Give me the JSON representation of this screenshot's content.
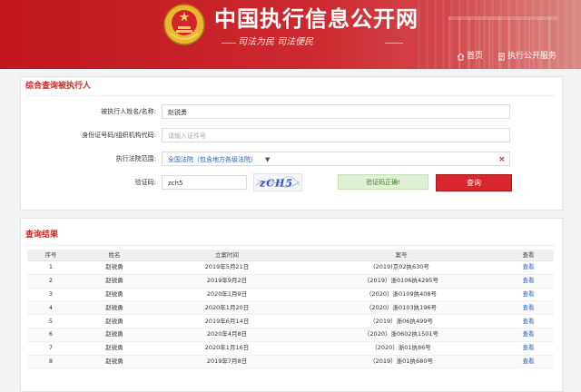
{
  "header": {
    "site_title": "中国执行信息公开网",
    "slogan": "司法为民  司法便民",
    "nav": [
      {
        "label": "首页",
        "icon": "home-icon"
      },
      {
        "label": "执行公开服务",
        "icon": "document-icon"
      }
    ]
  },
  "colors": {
    "brand_red": "#c1161e",
    "link_blue": "#2b63b8",
    "success_green": "#3f7d23"
  },
  "form": {
    "title": "综合查询被执行人",
    "name_label": "被执行人姓名/名称:",
    "name_value": "赵锐勇",
    "id_label": "身份证号码/组织机构代码:",
    "id_placeholder": "请输入证件号",
    "court_label": "执行法院范围:",
    "court_value": "全国法院（包含地方各级法院）",
    "captcha_label": "验证码:",
    "captcha_value": "zch5",
    "captcha_image_text": "zCH5",
    "verify_status": "验证码正确!",
    "submit_label": "查询"
  },
  "results": {
    "title": "查询结果",
    "columns": [
      "序号",
      "姓名",
      "立案时间",
      "案号",
      "查看"
    ],
    "rows": [
      {
        "no": "1",
        "name": "赵锐勇",
        "date": "2019年5月21日",
        "case": "(2019)京02执630号",
        "view": "查看"
      },
      {
        "no": "2",
        "name": "赵锐勇",
        "date": "2019年9月2日",
        "case": "（2019）浙0106执4295号",
        "view": "查看"
      },
      {
        "no": "3",
        "name": "赵锐勇",
        "date": "2020年1月9日",
        "case": "（2020）浙0109执408号",
        "view": "查看"
      },
      {
        "no": "4",
        "name": "赵锐勇",
        "date": "2020年1月20日",
        "case": "（2020）浙0103执196号",
        "view": "查看"
      },
      {
        "no": "5",
        "name": "赵锐勇",
        "date": "2019年6月14日",
        "case": "（2019）浙06执499号",
        "view": "查看"
      },
      {
        "no": "6",
        "name": "赵锐勇",
        "date": "2020年4月8日",
        "case": "（2020）浙0602执1501号",
        "view": "查看"
      },
      {
        "no": "7",
        "name": "赵锐勇",
        "date": "2020年1月16日",
        "case": "（2020）浙01执86号",
        "view": "查看"
      },
      {
        "no": "8",
        "name": "赵锐勇",
        "date": "2019年7月8日",
        "case": "（2019）浙01执680号",
        "view": "查看"
      }
    ]
  }
}
